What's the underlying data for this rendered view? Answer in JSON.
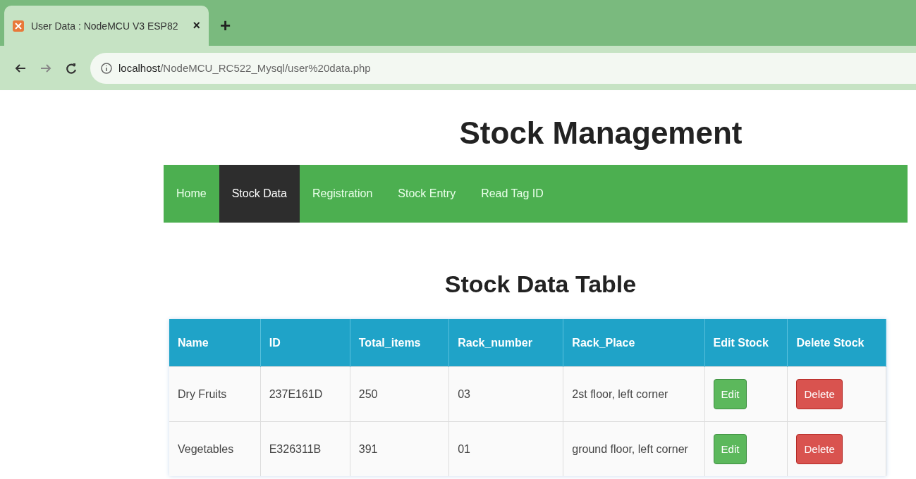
{
  "browser": {
    "tab_title": "User Data : NodeMCU V3 ESP82",
    "new_tab": "+",
    "close": "×",
    "url_host": "localhost",
    "url_path": "/NodeMCU_RC522_Mysql/user%20data.php"
  },
  "title": "Stock Management",
  "nav": [
    {
      "label": "Home",
      "selected": false
    },
    {
      "label": "Stock Data",
      "selected": true
    },
    {
      "label": "Registration",
      "selected": false
    },
    {
      "label": "Stock Entry",
      "selected": false
    },
    {
      "label": "Read Tag ID",
      "selected": false
    }
  ],
  "table_title": "Stock Data Table",
  "table": {
    "columns": [
      "Name",
      "ID",
      "Total_items",
      "Rack_number",
      "Rack_Place",
      "Edit Stock",
      "Delete Stock"
    ],
    "rows": [
      {
        "cells": [
          "Dry Fruits",
          "237E161D",
          "250",
          "03",
          "2st floor, left corner"
        ],
        "edit": "Edit",
        "delete": "Delete"
      },
      {
        "cells": [
          "Vegetables",
          "E326311B",
          "391",
          "01",
          "ground floor, left corner"
        ],
        "edit": "Edit",
        "delete": "Delete"
      }
    ]
  }
}
